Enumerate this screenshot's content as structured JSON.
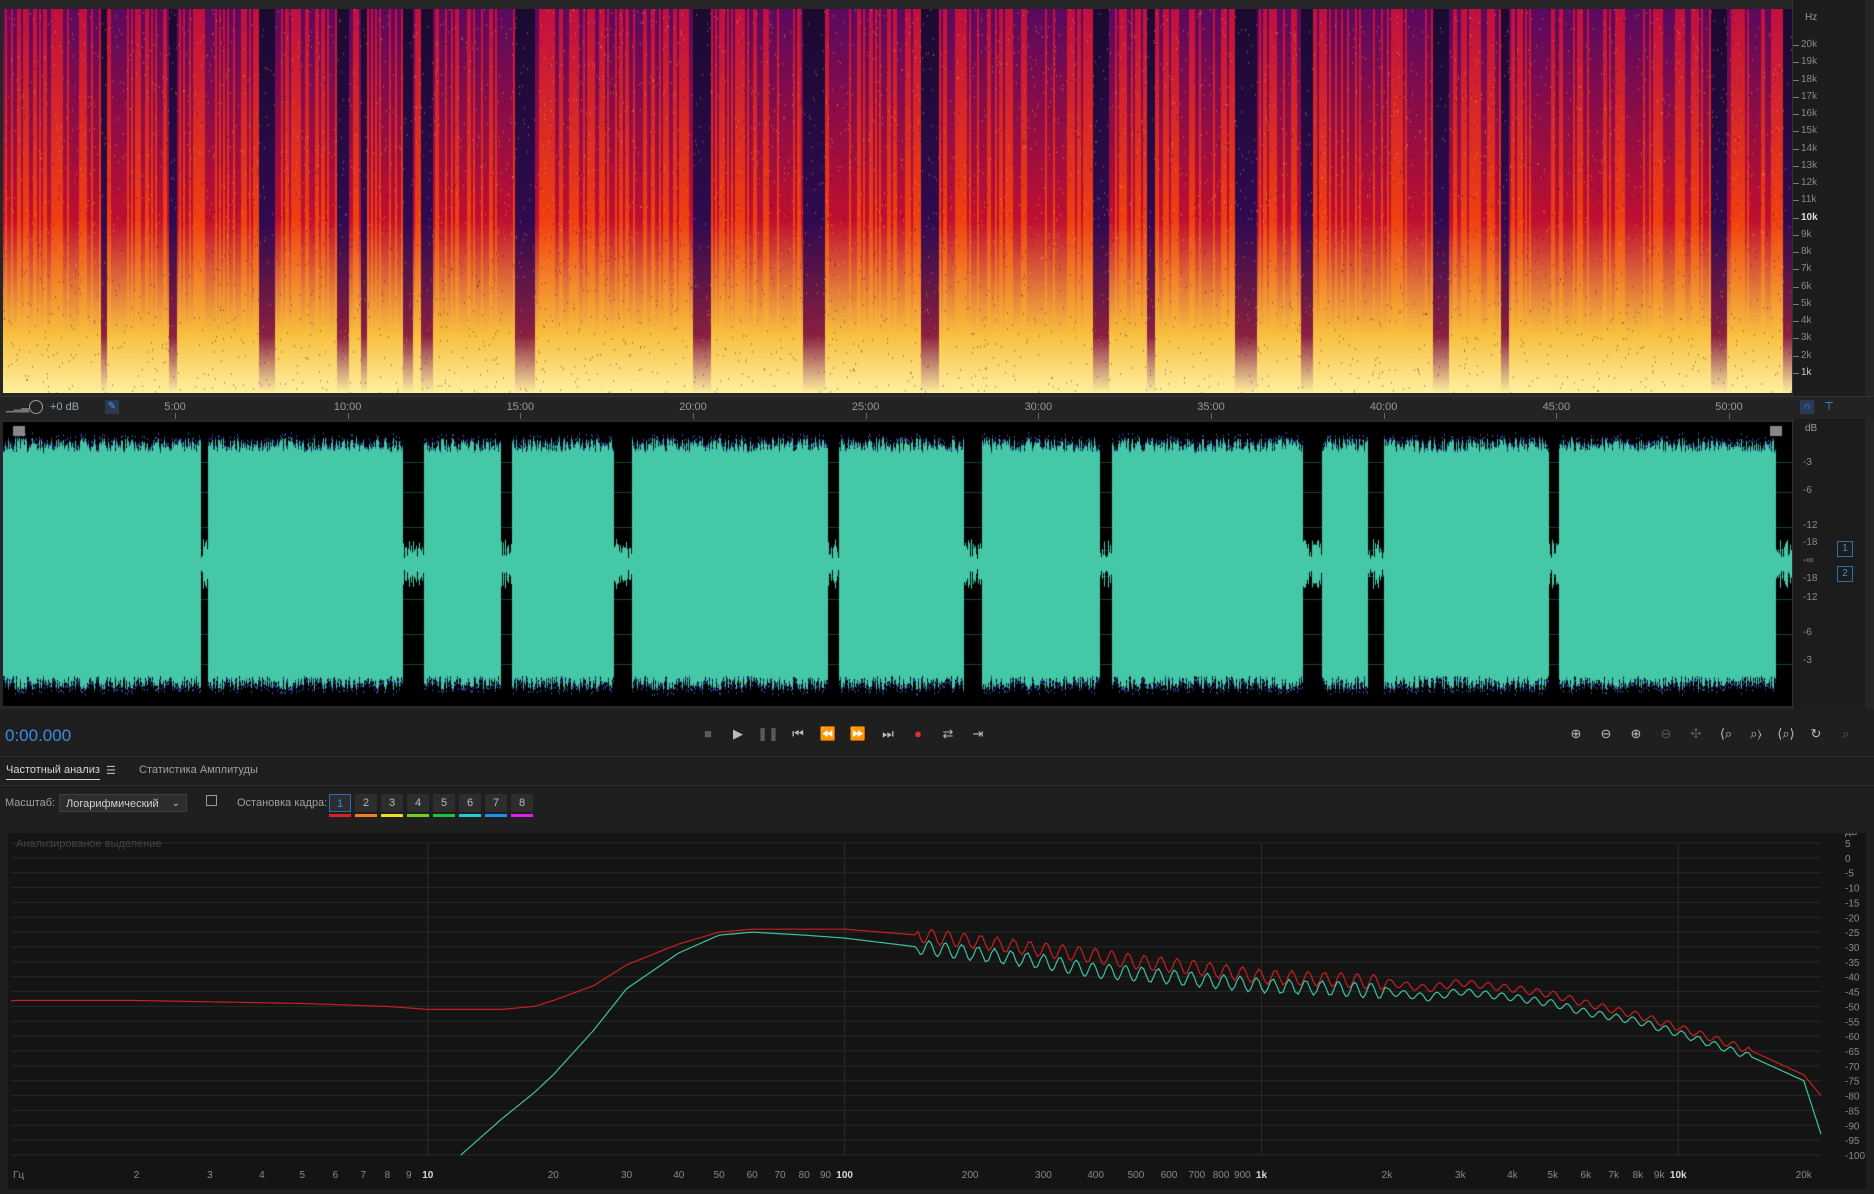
{
  "spectrogram": {
    "unit_label": "Hz",
    "freq_labels": [
      "20k",
      "19k",
      "18k",
      "17k",
      "16k",
      "15k",
      "14k",
      "13k",
      "12k",
      "11k",
      "10k",
      "9k",
      "8k",
      "7k",
      "6k",
      "5k",
      "4k",
      "3k",
      "2k",
      "1k"
    ]
  },
  "ruler": {
    "gain_label": "+0 dB",
    "time_labels": [
      "5:00",
      "10:00",
      "15:00",
      "20:00",
      "25:00",
      "30:00",
      "35:00",
      "40:00",
      "45:00",
      "50:00"
    ]
  },
  "waveform": {
    "unit_label": "dB",
    "db_labels_top": [
      "-3",
      "-6",
      "-12",
      "-18"
    ],
    "center_label": "-∞",
    "db_labels_bottom": [
      "-18",
      "-12",
      "-6",
      "-3"
    ],
    "channel_labels": [
      "1",
      "2"
    ],
    "color": "#44c8a8"
  },
  "transport": {
    "timecode": "0:00.000"
  },
  "analysis": {
    "tabs": [
      "Частотный анализ",
      "Статистика Амплитуды"
    ],
    "scale_label": "Масштаб:",
    "scale_value": "Логарифмический",
    "freeze_label": "Остановка кадра:",
    "frames": [
      "1",
      "2",
      "3",
      "4",
      "5",
      "6",
      "7",
      "8"
    ],
    "frame_colors": [
      "#e02020",
      "#f08020",
      "#e8e020",
      "#70d020",
      "#20c040",
      "#20d0d0",
      "#2090f0",
      "#e020e0"
    ],
    "plot_title": "Анализированое выделение"
  },
  "chart_data": {
    "type": "line",
    "xscale": "log",
    "xlim": [
      1,
      22000
    ],
    "ylim": [
      -100,
      5
    ],
    "xlabel": "Гц",
    "ylabel": "дБ",
    "x_tick_labels": [
      "2",
      "3",
      "4",
      "5",
      "6",
      "7",
      "8",
      "9",
      "10",
      "20",
      "30",
      "40",
      "50",
      "60",
      "70",
      "80",
      "90",
      "100",
      "200",
      "300",
      "400",
      "500",
      "600",
      "700",
      "800",
      "900",
      "1k",
      "2k",
      "3k",
      "4k",
      "5k",
      "6k",
      "7k",
      "8k",
      "9k",
      "10k",
      "20k"
    ],
    "y_tick_labels": [
      "5",
      "0",
      "-5",
      "-10",
      "-15",
      "-20",
      "-25",
      "-30",
      "-35",
      "-40",
      "-45",
      "-50",
      "-55",
      "-60",
      "-65",
      "-70",
      "-75",
      "-80",
      "-85",
      "-90",
      "-95",
      "-100"
    ],
    "series": [
      {
        "color": "#c82020",
        "x": [
          1,
          2,
          5,
          8,
          10,
          12,
          15,
          18,
          20,
          25,
          30,
          40,
          50,
          60,
          80,
          100,
          150,
          200,
          300,
          400,
          500,
          700,
          1000,
          1500,
          2000,
          2500,
          3000,
          4000,
          5000,
          6000,
          8000,
          10000,
          15000,
          20000,
          22000
        ],
        "y": [
          -48,
          -48,
          -49,
          -50,
          -51,
          -51,
          -51,
          -50,
          -48,
          -43,
          -36,
          -29,
          -25,
          -24,
          -24,
          -24,
          -26,
          -28,
          -31,
          -33,
          -35,
          -37,
          -40,
          -41,
          -42,
          -44,
          -42,
          -44,
          -46,
          -49,
          -53,
          -57,
          -65,
          -73,
          -80
        ]
      },
      {
        "color": "#40c0a0",
        "x": [
          12,
          15,
          18,
          20,
          25,
          30,
          40,
          50,
          60,
          80,
          100,
          150,
          200,
          300,
          400,
          500,
          700,
          1000,
          1500,
          2000,
          2500,
          3000,
          4000,
          5000,
          6000,
          8000,
          10000,
          15000,
          20000,
          22000
        ],
        "y": [
          -100,
          -88,
          -79,
          -73,
          -58,
          -44,
          -32,
          -26,
          -25,
          -26,
          -27,
          -30,
          -32,
          -35,
          -38,
          -39,
          -41,
          -43,
          -44,
          -45,
          -47,
          -45,
          -47,
          -49,
          -52,
          -55,
          -59,
          -67,
          -75,
          -93
        ]
      }
    ]
  }
}
